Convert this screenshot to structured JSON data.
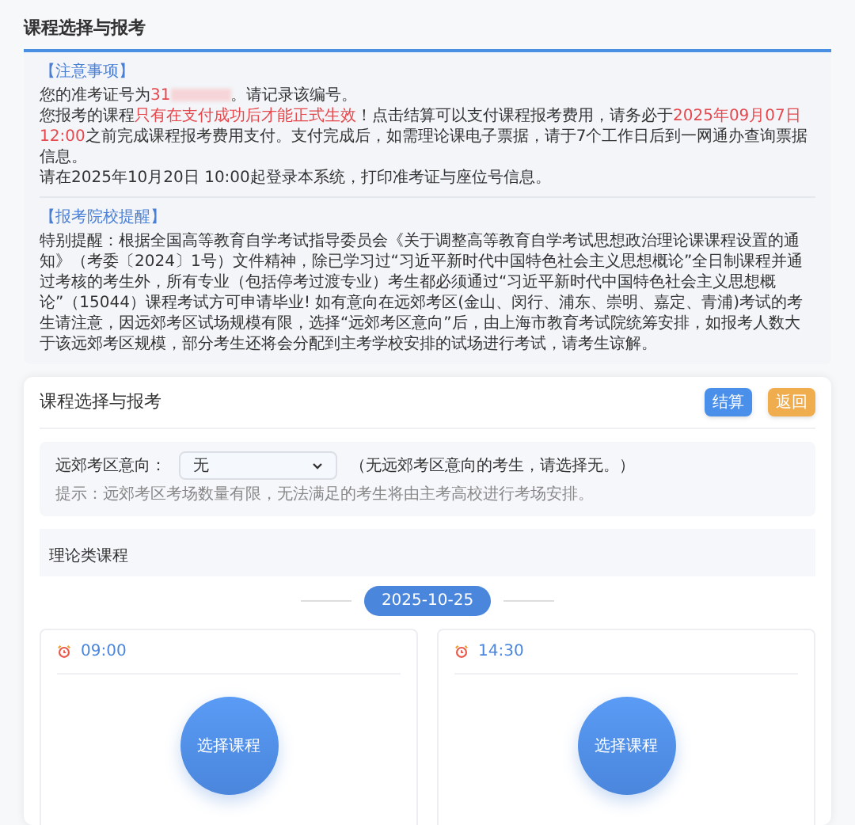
{
  "page_title": "课程选择与报考",
  "notice": {
    "heading": "【注意事项】",
    "paragraphs": [
      [
        {
          "text": "您的准考证号为",
          "highlight": false
        },
        {
          "text": "31",
          "highlight": true,
          "redacted": true
        },
        {
          "text": "。请记录该编号。",
          "highlight": false
        }
      ],
      [
        {
          "text": "您报考的课程",
          "highlight": false
        },
        {
          "text": "只有在支付成功后才能正式生效",
          "highlight": true
        },
        {
          "text": "！点击结算可以支付课程报考费用，请务必于",
          "highlight": false
        },
        {
          "text": "2025年09月07日 12:00",
          "highlight": true
        },
        {
          "text": "之前完成课程报考费用支付。支付完成后，如需理论课电子票据，请于7个工作日后到一网通办查询票据信息。",
          "highlight": false
        }
      ],
      [
        {
          "text": "请在2025年10月20日 10:00起登录本系统，打印准考证与座位号信息。",
          "highlight": false
        }
      ]
    ]
  },
  "reminder": {
    "heading": "【报考院校提醒】",
    "text": "特别提醒：根据全国高等教育自学考试指导委员会《关于调整高等教育自学考试思想政治理论课课程设置的通知》（考委〔2024〕1号）文件精神，除已学习过“习近平新时代中国特色社会主义思想概论”全日制课程并通过考核的考生外，所有专业（包括停考过渡专业）考生都必须通过“习近平新时代中国特色社会主义思想概论”（15044）课程考试方可申请毕业! 如有意向在远郊考区(金山、闵行、浦东、崇明、嘉定、青浦)考试的考生请注意，因远郊考区试场规模有限，选择“远郊考区意向”后，由上海市教育考试院统筹安排，如报考人数大于该远郊考区规模，部分考生还将会分配到主考学校安排的试场进行考试，请考生谅解。"
  },
  "card": {
    "title": "课程选择与报考",
    "buttons": [
      {
        "label": "结算",
        "kind": "primary"
      },
      {
        "label": "返回",
        "kind": "warning"
      }
    ],
    "district": {
      "label": "远郊考区意向：",
      "value": "无",
      "note": "（无远郊考区意向的考生，请选择无。）",
      "hint": "提示：远郊考区考场数量有限，无法满足的考生将由主考高校进行考场安排。"
    },
    "section": "理论类课程",
    "date": "2025-10-25",
    "sessions": [
      {
        "time": "09:00",
        "button": "选择课程"
      },
      {
        "time": "14:30",
        "button": "选择课程"
      }
    ]
  }
}
